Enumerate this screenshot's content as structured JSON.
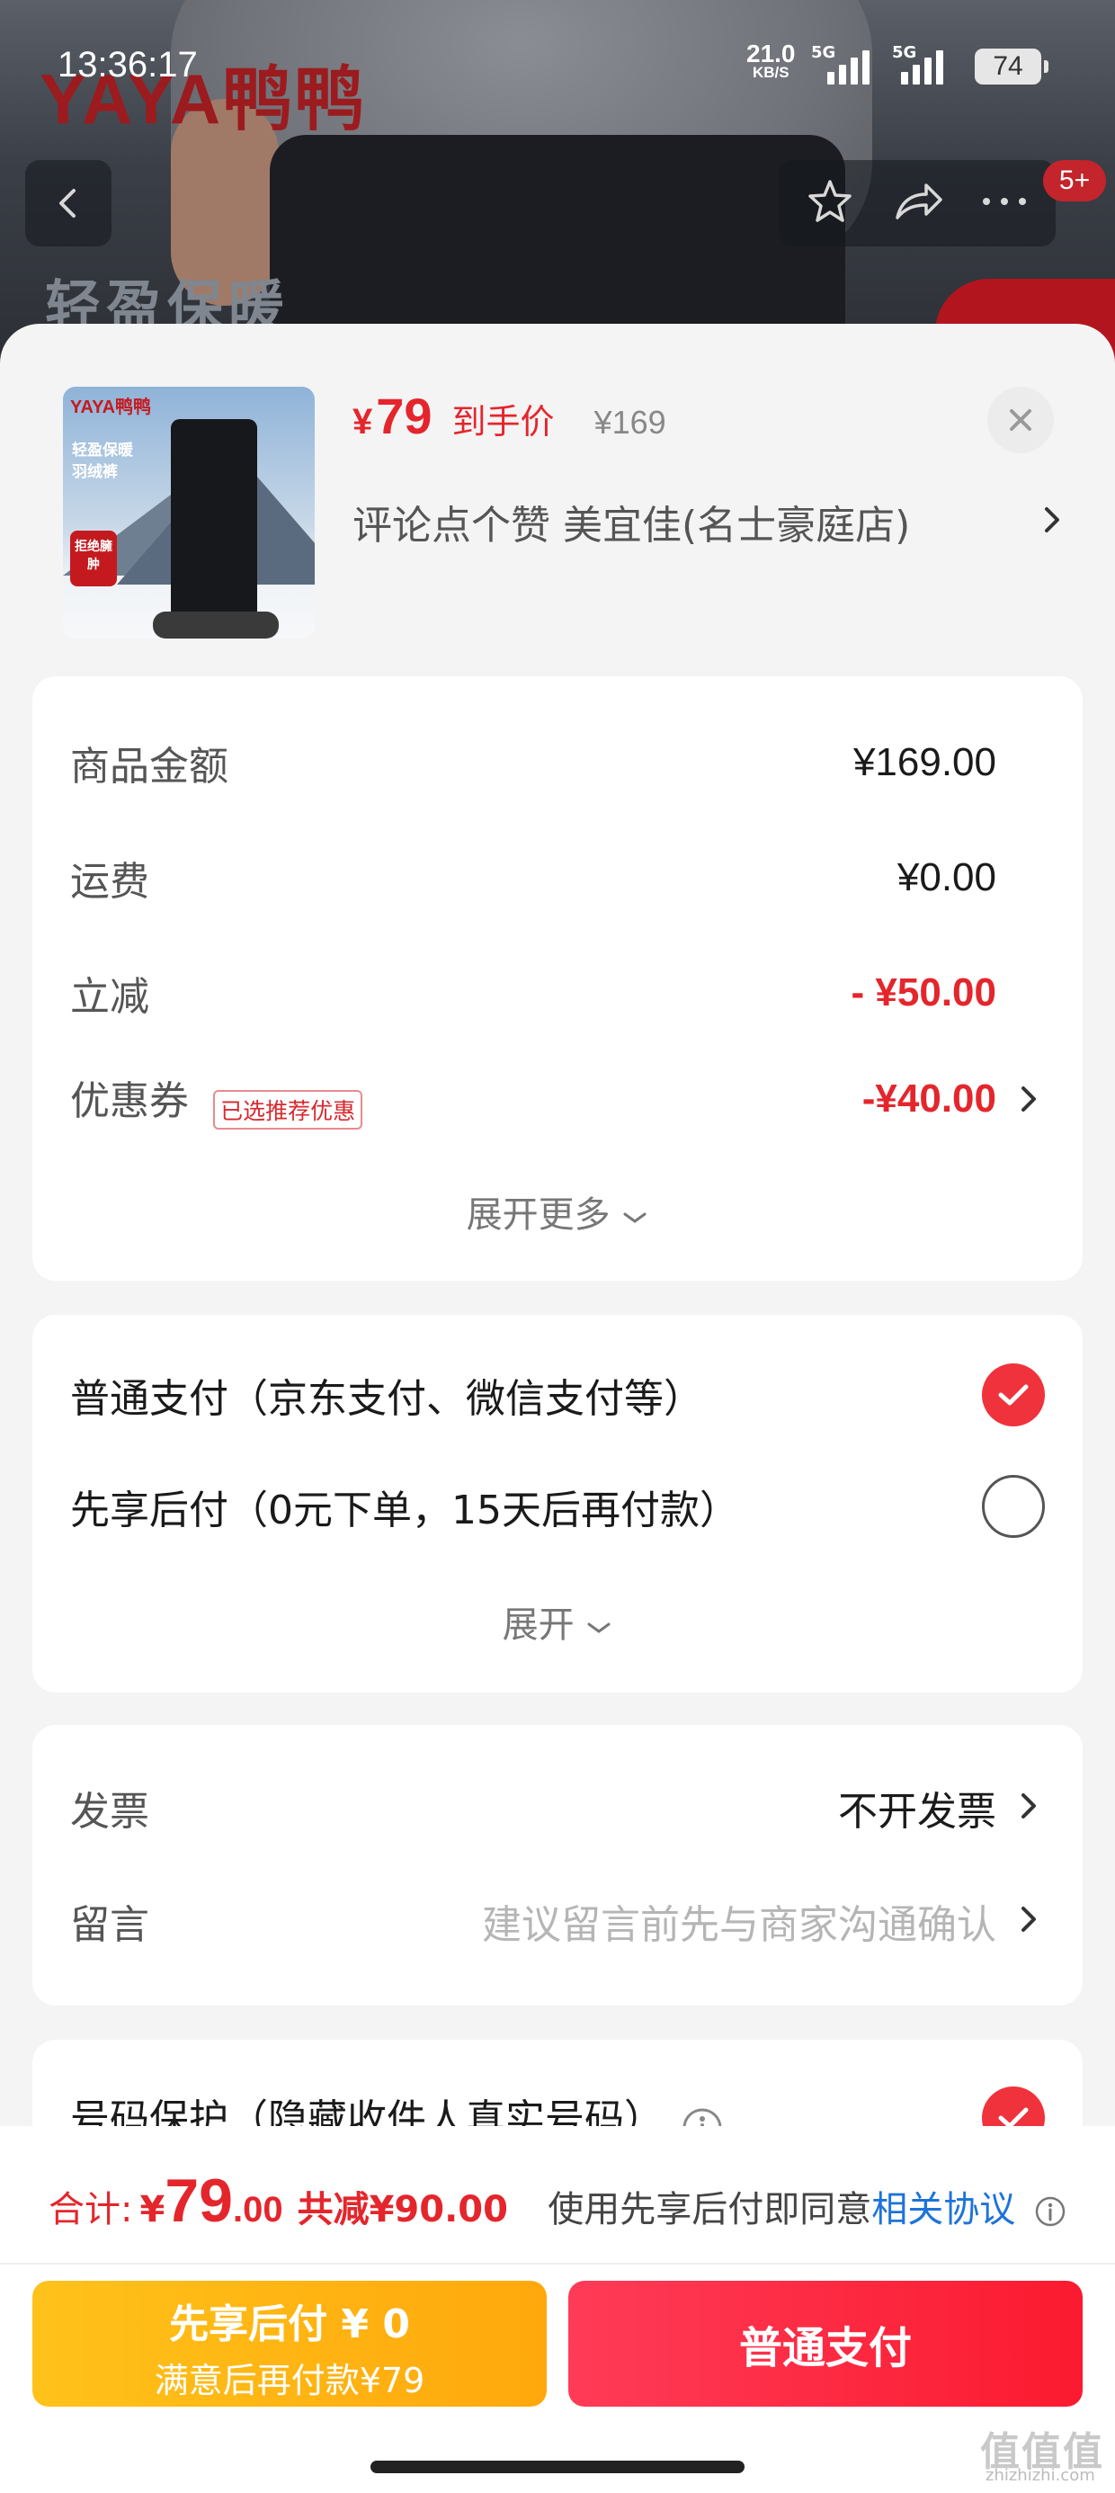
{
  "status_bar": {
    "time": "13:36:17",
    "net_speed": "21.0",
    "net_unit": "KB/S",
    "signal1_label": "5G",
    "signal2_label": "5G",
    "battery": "74"
  },
  "background": {
    "brand": "YAYA鸭鸭",
    "slogan": "轻盈保暖",
    "message_badge": "5+"
  },
  "product": {
    "thumb_brand": "YAYA鸭鸭",
    "thumb_line1": "轻盈保暖",
    "thumb_line2": "羽绒裤",
    "thumb_badge": "拒绝臃肿",
    "price_symbol": "¥",
    "price_now": "79",
    "price_tag": "到手价",
    "price_old": "¥169",
    "shop": "评论点个赞  美宜佳(名士豪庭店)"
  },
  "cost": {
    "goods_label": "商品金额",
    "goods_value": "¥169.00",
    "shipping_label": "运费",
    "shipping_value": "¥0.00",
    "discount_label": "立减",
    "discount_value": "- ¥50.00",
    "coupon_label": "优惠券",
    "coupon_tag": "已选推荐优惠",
    "coupon_value": "-¥40.00",
    "expand_label": "展开更多"
  },
  "payment": {
    "option1": "普通支付（京东支付、微信支付等）",
    "option2": "先享后付（0元下单，15天后再付款）",
    "expand_label": "展开"
  },
  "extras": {
    "invoice_label": "发票",
    "invoice_value": "不开发票",
    "note_label": "留言",
    "note_placeholder": "建议留言前先与商家沟通确认"
  },
  "privacy": {
    "label": "号码保护（隐藏收件人真实号码）"
  },
  "footer": {
    "total_label": "合计:",
    "total_yen": "¥",
    "total_int": "79",
    "total_dec": ".00",
    "total_saved": "共减¥90.00",
    "agree_prefix": "使用先享后付即同意",
    "agree_link": "相关协议",
    "btn_later_line1": "先享后付 ¥ 0",
    "btn_later_line2": "满意后再付款¥79",
    "btn_pay": "普通支付"
  },
  "watermark": {
    "text": "值值值",
    "sub": "zhizhizhi.com"
  },
  "colors": {
    "accent_red": "#e4262c",
    "pay_later_yellow": "#ffb414",
    "link_blue": "#1e73d8"
  }
}
